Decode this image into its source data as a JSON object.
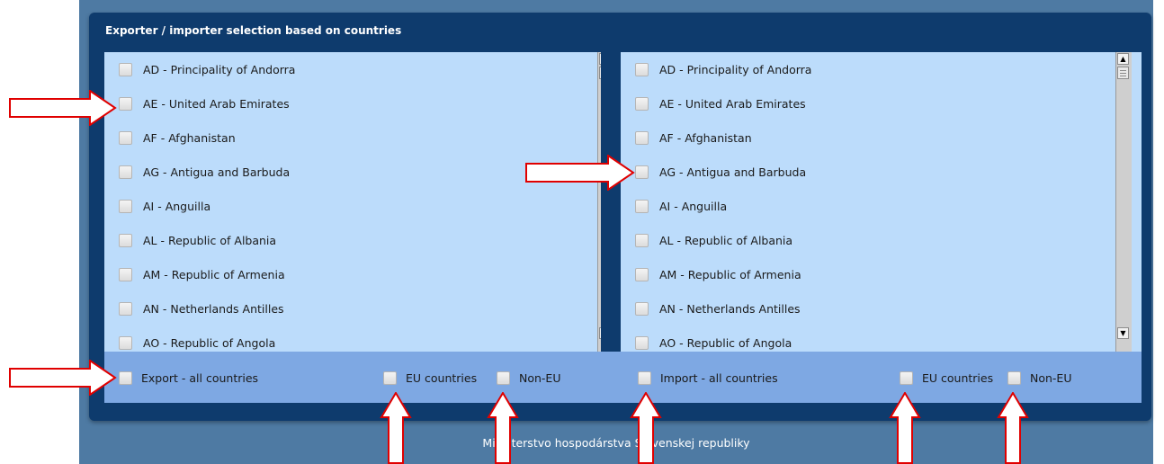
{
  "panel": {
    "title": "Exporter / importer selection based on countries"
  },
  "exporters": [
    "AD - Principality of Andorra",
    "AE - United Arab Emirates",
    "AF - Afghanistan",
    "AG - Antigua and Barbuda",
    "AI - Anguilla",
    "AL - Republic of Albania",
    "AM - Republic of Armenia",
    "AN - Netherlands Antilles",
    "AO - Republic of Angola"
  ],
  "importers": [
    "AD - Principality of Andorra",
    "AE - United Arab Emirates",
    "AF - Afghanistan",
    "AG - Antigua and Barbuda",
    "AI - Anguilla",
    "AL - Republic of Albania",
    "AM - Republic of Armenia",
    "AN - Netherlands Antilles",
    "AO - Republic of Angola"
  ],
  "options": {
    "export_all": "Export - all countries",
    "export_eu": "EU countries",
    "export_noneu": "Non-EU",
    "import_all": "Import - all countries",
    "import_eu": "EU countries",
    "import_noneu": "Non-EU"
  },
  "footer": "Ministerstvo hospodárstva Slovenskej republiky",
  "colors": {
    "panel": "#0e3b6d",
    "list_bg": "#bcdcfb",
    "bottom_bar": "#7ea8e3",
    "outer": "#4e7aa3",
    "annotation_arrow": "#e00000"
  }
}
